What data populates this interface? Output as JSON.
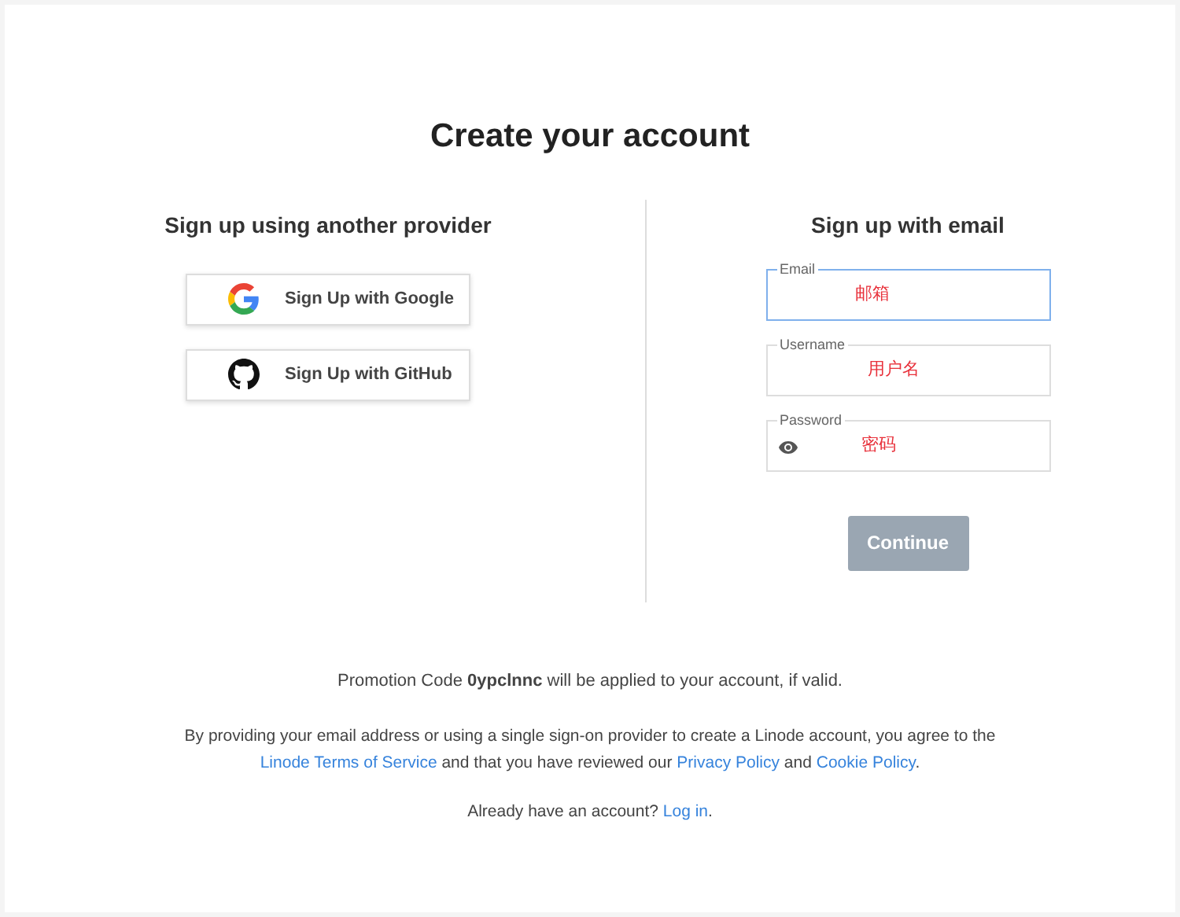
{
  "title": "Create your account",
  "providers": {
    "heading": "Sign up using another provider",
    "buttons": [
      {
        "kind": "google",
        "label": "Sign Up with Google"
      },
      {
        "kind": "github",
        "label": "Sign Up with GitHub"
      }
    ]
  },
  "email_form": {
    "heading": "Sign up with email",
    "fields": [
      {
        "kind": "text",
        "label": "Email",
        "value": "邮箱",
        "focused": true
      },
      {
        "kind": "text",
        "label": "Username",
        "value": "用户名",
        "focused": false
      },
      {
        "kind": "password",
        "label": "Password",
        "value": "密码",
        "focused": false
      }
    ],
    "submit": {
      "label": "Continue",
      "disabled": true
    }
  },
  "promotion": "Promotion Code **0ypclnnc** will be applied to your account, if valid.",
  "terms": [
    {
      "kind": "text",
      "text": "By providing your email address or using a single sign-on provider to create a Linode account, you agree to the "
    },
    {
      "kind": "link",
      "text": "Linode Terms of Service"
    },
    {
      "kind": "text",
      "text": " and that you have reviewed our "
    },
    {
      "kind": "link",
      "text": "Privacy Policy"
    },
    {
      "kind": "text",
      "text": " and "
    },
    {
      "kind": "link",
      "text": "Cookie Policy"
    },
    {
      "kind": "text",
      "text": "."
    }
  ],
  "login": [
    {
      "kind": "text",
      "text": "Already have an account? "
    },
    {
      "kind": "link",
      "text": "Log in"
    },
    {
      "kind": "text",
      "text": "."
    }
  ]
}
